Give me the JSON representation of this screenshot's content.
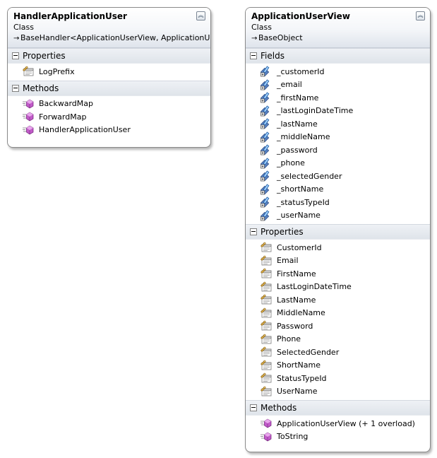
{
  "left_class": {
    "name": "HandlerApplicationUser",
    "kind": "Class",
    "base": "BaseHandler<ApplicationUserView, ApplicationUser>",
    "sections": [
      {
        "title": "Properties",
        "icon": "property-icon",
        "members": [
          "LogPrefix"
        ]
      },
      {
        "title": "Methods",
        "icon": "method-icon",
        "members": [
          "BackwardMap",
          "ForwardMap",
          "HandlerApplicationUser"
        ]
      }
    ]
  },
  "right_class": {
    "name": "ApplicationUserView",
    "kind": "Class",
    "base": "BaseObject",
    "sections": [
      {
        "title": "Fields",
        "icon": "field-icon",
        "members": [
          "_customerId",
          "_email",
          "_firstName",
          "_lastLoginDateTime",
          "_lastName",
          "_middleName",
          "_password",
          "_phone",
          "_selectedGender",
          "_shortName",
          "_statusTypeId",
          "_userName"
        ]
      },
      {
        "title": "Properties",
        "icon": "property-icon",
        "members": [
          "CustomerId",
          "Email",
          "FirstName",
          "LastLoginDateTime",
          "LastName",
          "MiddleName",
          "Password",
          "Phone",
          "SelectedGender",
          "ShortName",
          "StatusTypeId",
          "UserName"
        ]
      },
      {
        "title": "Methods",
        "icon": "method-icon",
        "members": [
          "ApplicationUserView (+ 1 overload)",
          "ToString"
        ]
      }
    ]
  }
}
